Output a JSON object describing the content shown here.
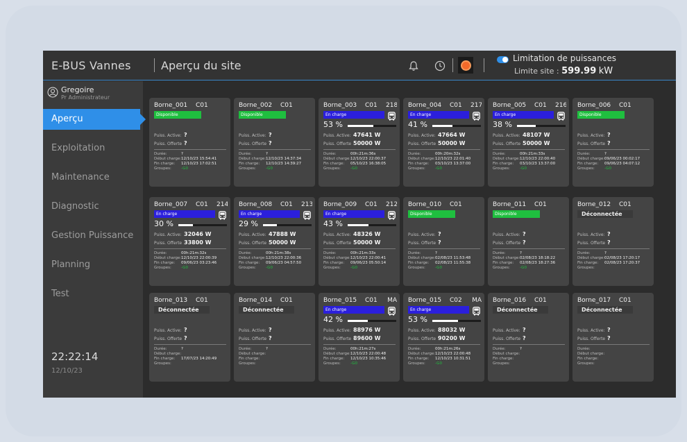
{
  "header": {
    "app_title": "E-BUS  Vannes",
    "page_title": "Aperçu du site",
    "limit_label": "Limitation de puissances",
    "limit_site_label": "Limite site  :",
    "limit_site_value": "599.99",
    "limit_site_unit": "kW",
    "limit_toggle_on": true,
    "icons": [
      "bell-icon",
      "clock-icon",
      "alarm-icon"
    ]
  },
  "sidebar": {
    "user_name": "Gregoire",
    "user_role": "Pr Administrateur",
    "items": [
      {
        "label": "Aperçu",
        "active": true
      },
      {
        "label": "Exploitation",
        "active": false
      },
      {
        "label": "Maintenance",
        "active": false
      },
      {
        "label": "Diagnostic",
        "active": false
      },
      {
        "label": "Gestion Puissance",
        "active": false
      },
      {
        "label": "Planning",
        "active": false
      },
      {
        "label": "Test",
        "active": false
      }
    ],
    "time": "22:22:14",
    "date": "12/10/23"
  },
  "labels": {
    "puiss_active": "Puiss. Active:",
    "puiss_offerte": "Puiss. Offerte",
    "duree": "Durée:",
    "debut": "Début charge:",
    "fin": "Fin charge:",
    "groupes": "Groupes:"
  },
  "colors": {
    "accent": "#2f8fe8",
    "disponible": "#1fbf3f",
    "en_charge": "#2b1fdc",
    "alarm": "#f26a2a"
  },
  "bornes": [
    {
      "name": "Borne_001",
      "conn": "C01",
      "power": "",
      "status": "Disponible",
      "type": "dispo",
      "pct": "",
      "pct_value": 0,
      "active": "?",
      "offerte": "?",
      "duree": "?",
      "debut": "12/10/23 15:54:41",
      "fin": "12/10/23 17:02:51",
      "groupes": "-G0"
    },
    {
      "name": "Borne_002",
      "conn": "C01",
      "power": "",
      "status": "Disponible",
      "type": "dispo",
      "pct": "",
      "pct_value": 0,
      "active": "?",
      "offerte": "?",
      "duree": "?",
      "debut": "12/10/23 14:37:34",
      "fin": "12/10/23 14:39:27",
      "groupes": "-G0"
    },
    {
      "name": "Borne_003",
      "conn": "C01",
      "power": "218",
      "status": "En charge",
      "type": "charge",
      "pct": "53 %",
      "pct_value": 53,
      "active": "47641 W",
      "offerte": "50000 W",
      "duree": "00h:21m:36s",
      "debut": "12/10/23 22:00:37",
      "fin": "05/10/23 16:38:05",
      "groupes": "-G0"
    },
    {
      "name": "Borne_004",
      "conn": "C01",
      "power": "217",
      "status": "En charge",
      "type": "charge",
      "pct": "41 %",
      "pct_value": 41,
      "active": "47664 W",
      "offerte": "50000 W",
      "duree": "00h:20m:32s",
      "debut": "12/10/23 22:01:40",
      "fin": "03/10/23 13:37:00",
      "groupes": "-G0"
    },
    {
      "name": "Borne_005",
      "conn": "C01",
      "power": "216",
      "status": "En charge",
      "type": "charge",
      "pct": "38 %",
      "pct_value": 38,
      "active": "48107 W",
      "offerte": "50000 W",
      "duree": "00h:21m:33s",
      "debut": "12/10/23 22:00:40",
      "fin": "03/10/23 13:37:00",
      "groupes": "-G0"
    },
    {
      "name": "Borne_006",
      "conn": "C01",
      "power": "",
      "status": "Disponible",
      "type": "dispo",
      "pct": "",
      "pct_value": 0,
      "active": "?",
      "offerte": "?",
      "duree": "?",
      "debut": "09/06/23 00:02:17",
      "fin": "09/06/23 04:07:12",
      "groupes": "-G0"
    },
    {
      "name": "Borne_007",
      "conn": "C01",
      "power": "214",
      "status": "En charge",
      "type": "charge",
      "pct": "30 %",
      "pct_value": 30,
      "active": "32046 W",
      "offerte": "33800 W",
      "duree": "00h:21m:32s",
      "debut": "12/10/23 22:00:39",
      "fin": "09/06/23 03:23:46",
      "groupes": "-G0"
    },
    {
      "name": "Borne_008",
      "conn": "C01",
      "power": "213",
      "status": "En charge",
      "type": "charge",
      "pct": "29 %",
      "pct_value": 29,
      "active": "47888 W",
      "offerte": "50000 W",
      "duree": "00h:21m:38s",
      "debut": "12/10/23 22:00:36",
      "fin": "09/06/23 04:57:50",
      "groupes": "-G0"
    },
    {
      "name": "Borne_009",
      "conn": "C01",
      "power": "212",
      "status": "En charge",
      "type": "charge",
      "pct": "43 %",
      "pct_value": 43,
      "active": "48326 W",
      "offerte": "50000 W",
      "duree": "00h:21m:33s",
      "debut": "12/10/23 22:00:41",
      "fin": "09/06/23 05:50:14",
      "groupes": "-G0"
    },
    {
      "name": "Borne_010",
      "conn": "C01",
      "power": "",
      "status": "Disponible",
      "type": "dispo",
      "pct": "",
      "pct_value": 0,
      "active": "?",
      "offerte": "?",
      "duree": "?",
      "debut": "02/08/23 11:53:48",
      "fin": "02/08/23 11:55:38",
      "groupes": "-G0"
    },
    {
      "name": "Borne_011",
      "conn": "C01",
      "power": "",
      "status": "Disponible",
      "type": "dispo",
      "pct": "",
      "pct_value": 0,
      "active": "?",
      "offerte": "?",
      "duree": "?",
      "debut": "02/08/23 18:18:22",
      "fin": "02/08/23 18:27:36",
      "groupes": "-G0"
    },
    {
      "name": "Borne_012",
      "conn": "C01",
      "power": "",
      "status": "Déconnectée",
      "type": "deco",
      "pct": "",
      "pct_value": 0,
      "active": "?",
      "offerte": "?",
      "duree": "?",
      "debut": "02/08/23 17:20:17",
      "fin": "02/08/23 17:20:37",
      "groupes": ""
    },
    {
      "name": "Borne_013",
      "conn": "C01",
      "power": "",
      "status": "Déconnectée",
      "type": "deco",
      "pct": "",
      "pct_value": 0,
      "active": "?",
      "offerte": "?",
      "duree": "?",
      "debut": "",
      "fin": "17/07/23 14:20:49",
      "groupes": ""
    },
    {
      "name": "Borne_014",
      "conn": "C01",
      "power": "",
      "status": "Déconnectée",
      "type": "deco",
      "pct": "",
      "pct_value": 0,
      "active": "?",
      "offerte": "?",
      "duree": "?",
      "debut": "",
      "fin": "",
      "groupes": ""
    },
    {
      "name": "Borne_015",
      "conn": "C01",
      "power": "MA",
      "status": "En charge",
      "type": "charge",
      "pct": "42 %",
      "pct_value": 42,
      "active": "88976 W",
      "offerte": "89600 W",
      "duree": "00h:21m:27s",
      "debut": "12/10/23 22:00:48",
      "fin": "12/10/23 10:35:46",
      "groupes": "-G0"
    },
    {
      "name": "Borne_015",
      "conn": "C02",
      "power": "MA",
      "status": "En charge",
      "type": "charge",
      "pct": "53 %",
      "pct_value": 53,
      "active": "88032 W",
      "offerte": "90200 W",
      "duree": "00h:21m:26s",
      "debut": "12/10/23 22:00:48",
      "fin": "12/10/23 10:31:51",
      "groupes": "-G0"
    },
    {
      "name": "Borne_016",
      "conn": "C01",
      "power": "",
      "status": "Déconnectée",
      "type": "deco",
      "pct": "",
      "pct_value": 0,
      "active": "?",
      "offerte": "?",
      "duree": "?",
      "debut": "",
      "fin": "",
      "groupes": ""
    },
    {
      "name": "Borne_017",
      "conn": "C01",
      "power": "",
      "status": "Déconnectée",
      "type": "deco",
      "pct": "",
      "pct_value": 0,
      "active": "?",
      "offerte": "?",
      "duree": "",
      "debut": "",
      "fin": "",
      "groupes": ""
    }
  ]
}
